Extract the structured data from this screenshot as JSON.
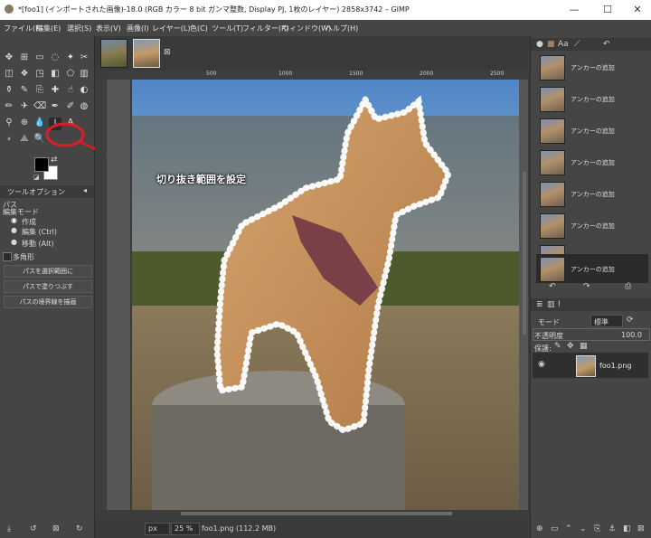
{
  "window": {
    "title": "*[foo1] (インポートされた画像)-18.0 (RGB カラー 8 bit ガンマ整数, Display PJ, 1枚のレイヤー) 2858x3742 – GIMP",
    "min": "—",
    "max": "☐",
    "close": "✕"
  },
  "menubar": [
    "ファイル(F)",
    "編集(E)",
    "選択(S)",
    "表示(V)",
    "画像(I)",
    "レイヤー(L)",
    "色(C)",
    "ツール(T)",
    "フィルター(R)",
    "ウィンドウ(W)",
    "ヘルプ(H)"
  ],
  "tool_options": {
    "tab_label": "ツールオプション",
    "tool_name": "パス",
    "mode_label": "編集モード",
    "modes": [
      "作成",
      "編集 (Ctrl)",
      "移動 (Alt)"
    ],
    "polygonal": "多角形",
    "buttons": [
      "パスを選択範囲に",
      "パスで塗りつぶす",
      "パスの境界線を描画"
    ]
  },
  "annotation": {
    "text": "切り抜き範囲を設定",
    "color": "#e01b24"
  },
  "ruler": {
    "marks": [
      "500",
      "1000",
      "1500",
      "2000",
      "2500"
    ]
  },
  "statusbar": {
    "unit": "px",
    "zoom": "25 %",
    "file": "foo1.png (112.2 MB)"
  },
  "history": {
    "item_label": "アンカーの追加",
    "count": 8
  },
  "layers": {
    "mode_label": "モード",
    "mode_value": "標準",
    "opacity_label": "不透明度",
    "opacity_value": "100.0",
    "lock_label": "保護:",
    "layer_name": "foo1.png"
  },
  "colors": {
    "accent": "#e01b24",
    "panel": "#454545",
    "selected_row": "#2b2b2b"
  }
}
